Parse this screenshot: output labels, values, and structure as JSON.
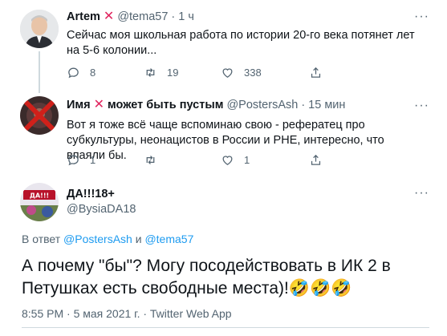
{
  "tweets": [
    {
      "name": "Artem",
      "name_marker": "✕",
      "handle": "@tema57",
      "dot": "·",
      "time": "1 ч",
      "text": "Сейчас моя школьная работа по истории 20-го века потянет лет на 5-6 колонии...",
      "replies": "8",
      "retweets": "19",
      "likes": "338"
    },
    {
      "name": "Имя",
      "name_marker": "✕",
      "name_suffix": "может быть пустым",
      "handle": "@PostersAsh",
      "dot": "·",
      "time": "15 мин",
      "text": "Вот я тоже всё чаще вспоминаю  свою - рефератец про субкультуры, неонацистов в России и РНЕ, интересно, что впаяли бы.",
      "replies": "1",
      "retweets": "",
      "likes": "1"
    }
  ],
  "main_tweet": {
    "name": "ДА!!!18+",
    "handle": "@BysiaDA18",
    "avatar_text": "ДА!!!",
    "reply_to_prefix": "В ответ",
    "reply_to_user1": "@PostersAsh",
    "reply_to_and": "и",
    "reply_to_user2": "@tema57",
    "text": "А почему \"бы\"? Могу посодействовать в ИК 2 в Петушках есть свободные места)!🤣🤣🤣",
    "meta": "8:55 PM · 5 мая 2021 г. · Twitter Web App"
  },
  "more_glyph": "···",
  "colors": {
    "accent": "#1d9bf0",
    "muted": "#536471",
    "text": "#0f1419",
    "cross": "#e0245e"
  }
}
